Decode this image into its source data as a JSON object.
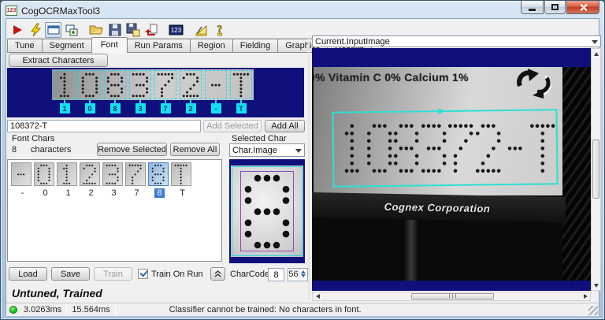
{
  "window": {
    "title": "CogOCRMaxTool3",
    "icon_label": "123"
  },
  "toolbar": {
    "icons": [
      "run",
      "electric-run",
      "show-current-record",
      "add-record-window",
      "open-file",
      "save-file",
      "save-as",
      "revert",
      "tool-id-123",
      "measure",
      "help"
    ]
  },
  "tabs": {
    "items": [
      "Tune",
      "Segment",
      "Font",
      "Run Params",
      "Region",
      "Fielding",
      "Graphics",
      "Results"
    ],
    "active": "Font"
  },
  "font_tab": {
    "extract_button": "Extract Characters",
    "preview": {
      "chars": [
        "1",
        "0",
        "8",
        "3",
        "7",
        "2",
        "-",
        "T"
      ]
    },
    "string_value": "108372-T",
    "add_selected": "Add Selected",
    "add_all": "Add All",
    "font_chars": {
      "title": "Font Chars",
      "count": "8",
      "count_suffix": "characters",
      "remove_selected": "Remove Selected",
      "remove_all": "Remove All",
      "chars": [
        "-",
        "0",
        "1",
        "2",
        "3",
        "7",
        "8",
        "T"
      ],
      "selected_char": "8"
    },
    "selected_char": {
      "title": "Selected Char",
      "view": "Char.Image",
      "glyph": "8",
      "charcode_label": "CharCode:",
      "char_field": "8",
      "code_field": "56"
    },
    "buttons": {
      "load": "Load",
      "save": "Save",
      "train": "Train"
    },
    "train_on_run": "Train On Run"
  },
  "display": {
    "source": "Current.InputImage",
    "nutrition_text": "0%  Vitamin C 0%  Calcium 1%",
    "code_text": "108372-T",
    "brand_text": "Cognex Corporation"
  },
  "status": {
    "tool_state": "Untuned, Trained",
    "time1": "3.0263ms",
    "time2": "15.564ms",
    "message": "Classifier cannot be trained: No characters in font."
  }
}
